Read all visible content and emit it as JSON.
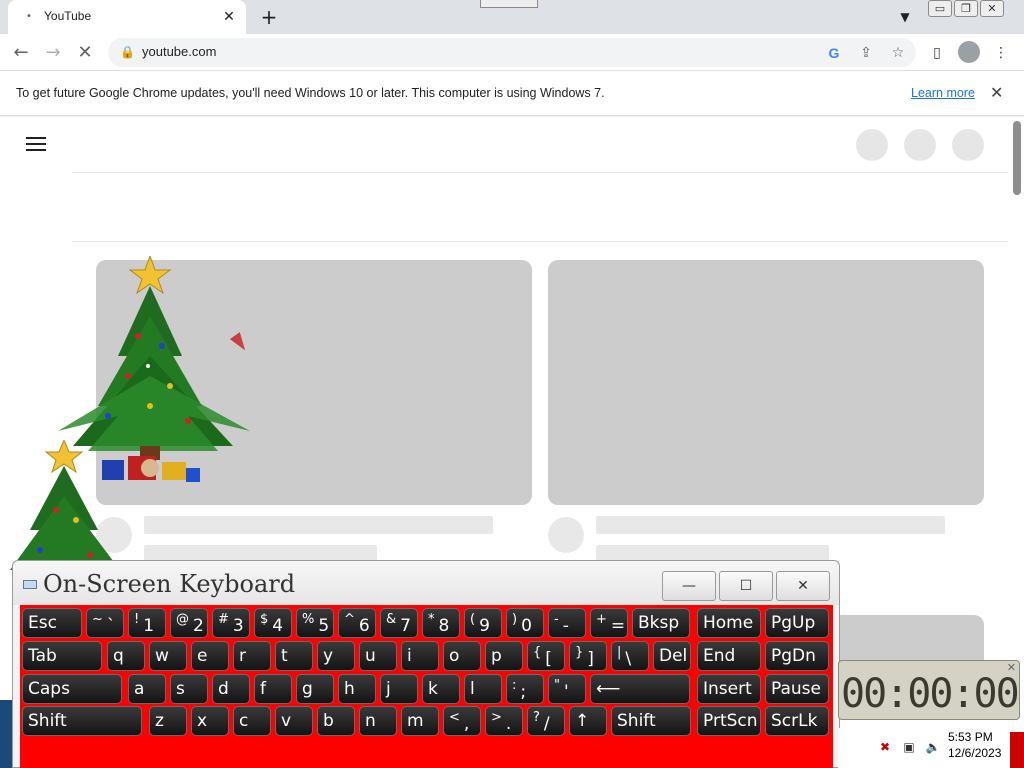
{
  "browser": {
    "tab_title": "YouTube",
    "tab_favicon": "loading-dot-icon",
    "tab_close": "✕",
    "new_tab": "+",
    "url": "youtube.com",
    "window_buttons": [
      "▭",
      "❐",
      "✕"
    ]
  },
  "infobar": {
    "message": "To get future Google Chrome updates, you'll need Windows 10 or later. This computer is using Windows 7.",
    "link": "Learn more",
    "close": "✕"
  },
  "keyboard": {
    "title": "On-Screen Keyboard",
    "window_buttons": [
      "—",
      "☐",
      "✕"
    ],
    "rows": [
      [
        {
          "sup": "",
          "main": "Esc"
        },
        {
          "sup": "~",
          "main": "`"
        },
        {
          "sup": "!",
          "main": "1"
        },
        {
          "sup": "@",
          "main": "2"
        },
        {
          "sup": "#",
          "main": "3"
        },
        {
          "sup": "$",
          "main": "4"
        },
        {
          "sup": "%",
          "main": "5"
        },
        {
          "sup": "^",
          "main": "6"
        },
        {
          "sup": "&",
          "main": "7"
        },
        {
          "sup": "*",
          "main": "8"
        },
        {
          "sup": "(",
          "main": "9"
        },
        {
          "sup": ")",
          "main": "0"
        },
        {
          "sup": "-",
          "main": "-"
        },
        {
          "sup": "+",
          "main": "="
        },
        {
          "sup": "",
          "main": "Bksp"
        },
        {
          "sup": "",
          "main": "Home"
        },
        {
          "sup": "",
          "main": "PgUp"
        }
      ],
      [
        {
          "sup": "",
          "main": "Tab"
        },
        {
          "sup": "",
          "main": "q"
        },
        {
          "sup": "",
          "main": "w"
        },
        {
          "sup": "",
          "main": "e"
        },
        {
          "sup": "",
          "main": "r"
        },
        {
          "sup": "",
          "main": "t"
        },
        {
          "sup": "",
          "main": "y"
        },
        {
          "sup": "",
          "main": "u"
        },
        {
          "sup": "",
          "main": "i"
        },
        {
          "sup": "",
          "main": "o"
        },
        {
          "sup": "",
          "main": "p"
        },
        {
          "sup": "{",
          "main": "["
        },
        {
          "sup": "}",
          "main": "]"
        },
        {
          "sup": "|",
          "main": "\\"
        },
        {
          "sup": "",
          "main": "Del"
        },
        {
          "sup": "",
          "main": "End"
        },
        {
          "sup": "",
          "main": "PgDn"
        }
      ],
      [
        {
          "sup": "",
          "main": "Caps"
        },
        {
          "sup": "",
          "main": "a"
        },
        {
          "sup": "",
          "main": "s"
        },
        {
          "sup": "",
          "main": "d"
        },
        {
          "sup": "",
          "main": "f"
        },
        {
          "sup": "",
          "main": "g"
        },
        {
          "sup": "",
          "main": "h"
        },
        {
          "sup": "",
          "main": "j"
        },
        {
          "sup": "",
          "main": "k"
        },
        {
          "sup": "",
          "main": "l"
        },
        {
          "sup": ":",
          "main": ";"
        },
        {
          "sup": "\"",
          "main": "'"
        },
        {
          "sup": "",
          "main": "⟵"
        },
        {
          "sup": "",
          "main": "Insert"
        },
        {
          "sup": "",
          "main": "Pause"
        }
      ],
      [
        {
          "sup": "",
          "main": "Shift"
        },
        {
          "sup": "",
          "main": "z"
        },
        {
          "sup": "",
          "main": "x"
        },
        {
          "sup": "",
          "main": "c"
        },
        {
          "sup": "",
          "main": "v"
        },
        {
          "sup": "",
          "main": "b"
        },
        {
          "sup": "",
          "main": "n"
        },
        {
          "sup": "",
          "main": "m"
        },
        {
          "sup": "<",
          "main": ","
        },
        {
          "sup": ">",
          "main": "."
        },
        {
          "sup": "?",
          "main": "/"
        },
        {
          "sup": "",
          "main": "↑"
        },
        {
          "sup": "",
          "main": "Shift"
        },
        {
          "sup": "",
          "main": "PrtScn"
        },
        {
          "sup": "",
          "main": "ScrLk"
        }
      ]
    ]
  },
  "clock_widget": {
    "digits": "00:00:00"
  },
  "taskbar": {
    "time": "5:53 PM",
    "date": "12/6/2023"
  },
  "colors": {
    "keyboard_bg": "#ff0000",
    "link": "#1a73e8",
    "thumbnail_placeholder": "#cccccc"
  }
}
